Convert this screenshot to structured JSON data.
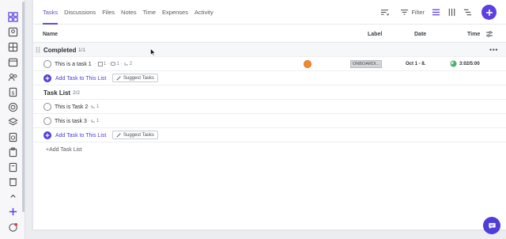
{
  "tabs": [
    "Tasks",
    "Discussions",
    "Files",
    "Notes",
    "Time",
    "Expenses",
    "Activity"
  ],
  "toolbar": {
    "filter_label": "Filter"
  },
  "columns": {
    "name": "Name",
    "label": "Label",
    "date": "Date",
    "time": "Time"
  },
  "groups": [
    {
      "title": "Completed",
      "count": "1/1",
      "tasks": [
        {
          "name": "This is a task 1",
          "subtasks": "1",
          "comments": "1",
          "dependencies": "2",
          "label": "ONBOARDI...",
          "date": "Oct 1 - 8.",
          "time": "3:02/5:00"
        }
      ],
      "add_label": "Add Task to This List",
      "suggest_label": "Suggest Tasks"
    },
    {
      "title": "Task List",
      "count": "2/2",
      "tasks": [
        {
          "name": "This is Task 2",
          "dependencies": "1"
        },
        {
          "name": "This is task 3",
          "dependencies": "1"
        }
      ],
      "add_label": "Add Task to This List",
      "suggest_label": "Suggest Tasks"
    }
  ],
  "add_list_label": "+Add Task List",
  "colors": {
    "accent": "#5b3fe0",
    "avatar": "#f08a2b",
    "label_chip": "#d4d5d9"
  }
}
